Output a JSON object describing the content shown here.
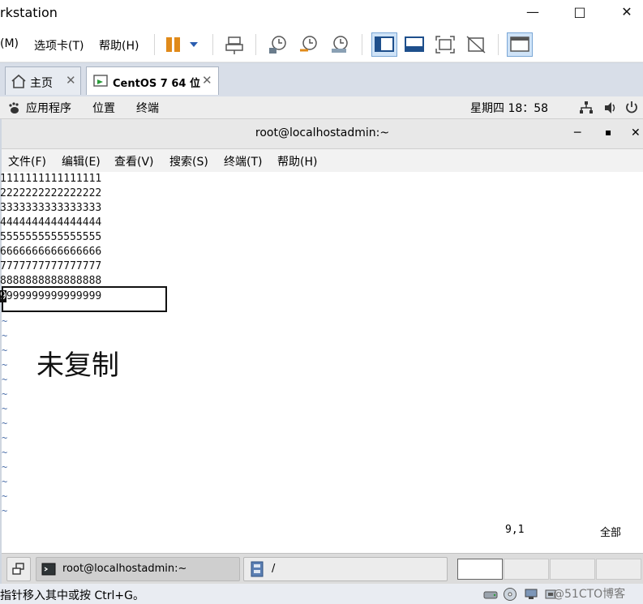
{
  "window": {
    "title": "rkstation"
  },
  "vmware_menu": [
    "(M)",
    "选项卡(T)",
    "帮助(H)"
  ],
  "tabs": [
    {
      "label": "主页"
    },
    {
      "label": "CentOS 7 64 位"
    }
  ],
  "gnome": {
    "apps": "应用程序",
    "places": "位置",
    "terminal": "终端",
    "clock": "星期四 18：58"
  },
  "terminal": {
    "title": "root@localhostadmin:~",
    "menu": [
      "文件(F)",
      "编辑(E)",
      "查看(V)",
      "搜索(S)",
      "终端(T)",
      "帮助(H)"
    ],
    "lines": [
      "1111111111111111",
      "2222222222222222",
      "3333333333333333",
      "4444444444444444",
      "5555555555555555",
      "6666666666666666",
      "7777777777777777",
      "8888888888888888"
    ],
    "cursor_char": "9",
    "last_line_rest": "999999999999999",
    "annotation": "未复制",
    "position": "9,1",
    "scroll": "全部"
  },
  "taskbar": {
    "item1": "root@localhostadmin:~",
    "item2": "/"
  },
  "vm_status": {
    "message": "指针移入其中或按 Ctrl+G。",
    "watermark": "@51CTO博客"
  }
}
